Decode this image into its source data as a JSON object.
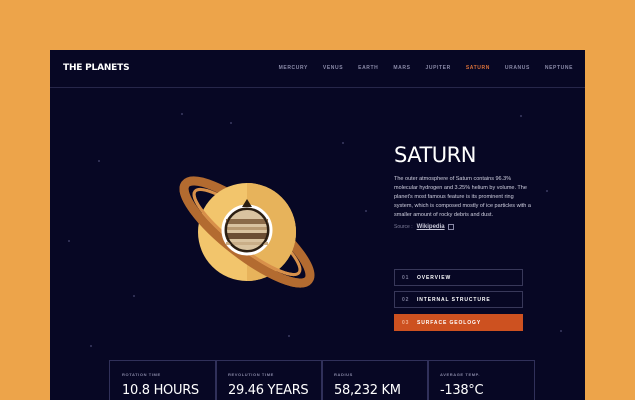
{
  "header": {
    "logo": "THE PLANETS",
    "nav": [
      "MERCURY",
      "VENUS",
      "EARTH",
      "MARS",
      "JUPITER",
      "SATURN",
      "URANUS",
      "NEPTUNE"
    ],
    "active_nav": "SATURN"
  },
  "planet": {
    "name": "SATURN",
    "description": "The outer atmosphere of Saturn contains 96.3% molecular hydrogen and 3.25% helium by volume. The planet's most famous feature is its prominent ring system, which is composed mostly of ice particles with a smaller amount of rocky debris and dust.",
    "source_label": "Source :",
    "source_link": "Wikipedia"
  },
  "tabs": [
    {
      "num": "01",
      "label": "OVERVIEW",
      "active": false
    },
    {
      "num": "02",
      "label": "INTERNAL STRUCTURE",
      "active": false
    },
    {
      "num": "03",
      "label": "SURFACE GEOLOGY",
      "active": true
    }
  ],
  "stats": [
    {
      "label": "ROTATION TIME",
      "value": "10.8 HOURS"
    },
    {
      "label": "REVOLUTION TIME",
      "value": "29.46 YEARS"
    },
    {
      "label": "RADIUS",
      "value": "58,232 KM"
    },
    {
      "label": "AVERAGE TEMP.",
      "value": "-138°C"
    }
  ],
  "colors": {
    "background": "#070724",
    "accent": "#CD5120",
    "page": "#EDA44A"
  }
}
